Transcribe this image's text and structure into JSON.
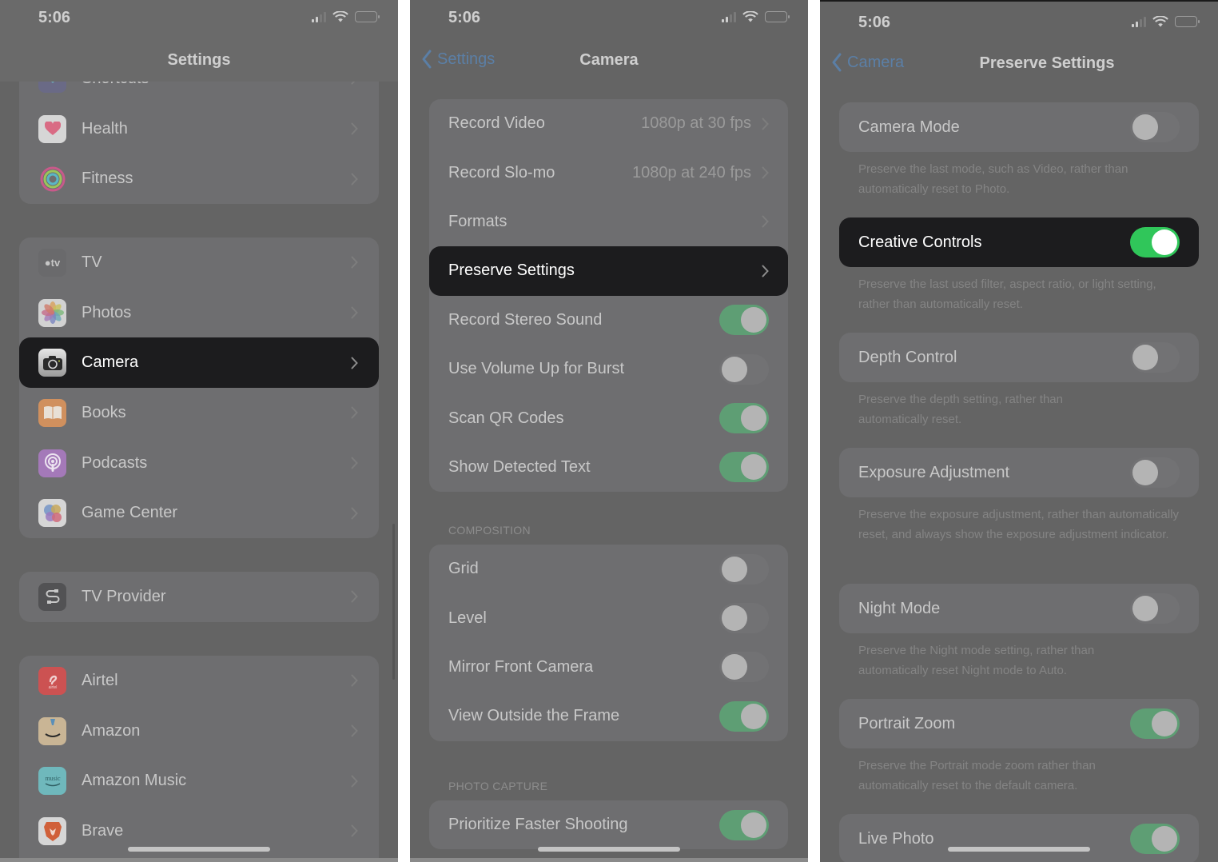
{
  "status_bar": {
    "time": "5:06"
  },
  "colors": {
    "overlay_gray": "#646464",
    "card_gray": "#6e6e70",
    "highlight_dark": "#1c1c1e",
    "toggle_on_dimmed": "#5e9e74",
    "toggle_on_active": "#30c65a",
    "link_blue": "#5b7fa6"
  },
  "panel1": {
    "title": "Settings",
    "groups": [
      {
        "items": [
          {
            "label": "Shortcuts",
            "icon": "shortcuts-icon"
          },
          {
            "label": "Health",
            "icon": "health-heart-icon"
          },
          {
            "label": "Fitness",
            "icon": "fitness-rings-icon"
          }
        ]
      },
      {
        "items": [
          {
            "label": "TV",
            "icon": "apple-tv-icon"
          },
          {
            "label": "Photos",
            "icon": "photos-flower-icon"
          },
          {
            "label": "Camera",
            "icon": "camera-icon",
            "selected": true
          },
          {
            "label": "Books",
            "icon": "books-icon"
          },
          {
            "label": "Podcasts",
            "icon": "podcasts-icon"
          },
          {
            "label": "Game Center",
            "icon": "game-center-icon"
          }
        ]
      },
      {
        "items": [
          {
            "label": "TV Provider",
            "icon": "tv-provider-icon"
          }
        ]
      },
      {
        "items": [
          {
            "label": "Airtel",
            "icon": "airtel-icon"
          },
          {
            "label": "Amazon",
            "icon": "amazon-icon"
          },
          {
            "label": "Amazon Music",
            "icon": "amazon-music-icon"
          },
          {
            "label": "Brave",
            "icon": "brave-lion-icon"
          }
        ]
      }
    ]
  },
  "panel2": {
    "back_label": "Settings",
    "title": "Camera",
    "group1": [
      {
        "label": "Record Video",
        "value": "1080p at 30 fps",
        "type": "nav"
      },
      {
        "label": "Record Slo-mo",
        "value": "1080p at 240 fps",
        "type": "nav"
      },
      {
        "label": "Formats",
        "value": "",
        "type": "nav"
      },
      {
        "label": "Preserve Settings",
        "value": "",
        "type": "nav",
        "selected": true
      },
      {
        "label": "Record Stereo Sound",
        "type": "toggle",
        "on": true
      },
      {
        "label": "Use Volume Up for Burst",
        "type": "toggle",
        "on": false
      },
      {
        "label": "Scan QR Codes",
        "type": "toggle",
        "on": true
      },
      {
        "label": "Show Detected Text",
        "type": "toggle",
        "on": true
      }
    ],
    "composition_header": "COMPOSITION",
    "composition": [
      {
        "label": "Grid",
        "on": false
      },
      {
        "label": "Level",
        "on": false
      },
      {
        "label": "Mirror Front Camera",
        "on": false
      },
      {
        "label": "View Outside the Frame",
        "on": true
      }
    ],
    "photo_capture_header": "PHOTO CAPTURE",
    "photo_capture": [
      {
        "label": "Prioritize Faster Shooting",
        "on": true
      }
    ]
  },
  "panel3": {
    "back_label": "Camera",
    "title": "Preserve Settings",
    "items": [
      {
        "label": "Camera Mode",
        "on": false,
        "footer": "Preserve the last mode, such as Video, rather than automatically reset to Photo."
      },
      {
        "label": "Creative Controls",
        "on": true,
        "selected": true,
        "footer": "Preserve the last used filter, aspect ratio, or light setting, rather than automatically reset."
      },
      {
        "label": "Depth Control",
        "on": false,
        "footer": "Preserve the depth setting, rather than automatically reset."
      },
      {
        "label": "Exposure Adjustment",
        "on": false,
        "footer": "Preserve the exposure adjustment, rather than automatically reset, and always show the exposure adjustment indicator."
      },
      {
        "label": "Night Mode",
        "on": false,
        "footer": "Preserve the Night mode setting, rather than automatically reset Night mode to Auto."
      },
      {
        "label": "Portrait Zoom",
        "on": true,
        "footer": "Preserve the Portrait mode zoom rather than automatically reset to the default camera."
      },
      {
        "label": "Live Photo",
        "on": true,
        "footer": ""
      }
    ]
  }
}
